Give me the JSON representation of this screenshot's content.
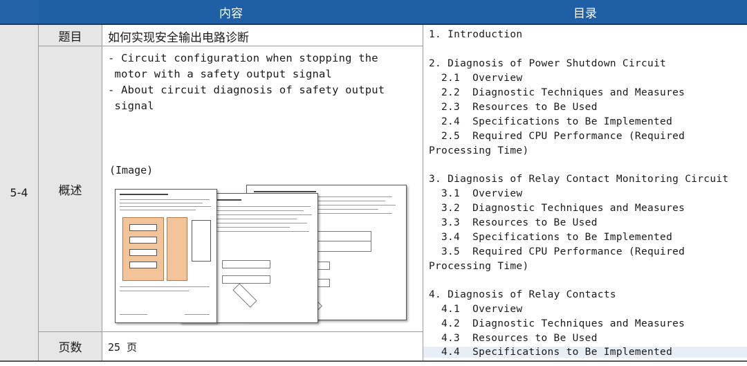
{
  "header": {
    "id_col": "",
    "content_col": "内容",
    "toc_col": "目录"
  },
  "row_id": "5-4",
  "rows": {
    "title": {
      "label": "题目",
      "value": "如何实现安全输出电路诊断"
    },
    "summary": {
      "label": "概述",
      "text": "- Circuit configuration when stopping the\n motor with a safety output signal\n- About circuit diagnosis of safety output\n signal",
      "image_label": "(Image)"
    },
    "pages": {
      "label": "页数",
      "value": "25 页"
    }
  },
  "toc": [
    "1. Introduction",
    "",
    "2. Diagnosis of Power Shutdown Circuit",
    "2.1  Overview",
    "2.2  Diagnostic Techniques and Measures",
    "2.3  Resources to Be Used",
    "2.4  Specifications to Be Implemented",
    "2.5  Required CPU Performance (Required",
    "Processing Time)",
    "",
    "3. Diagnosis of Relay Contact Monitoring Circuit",
    "3.1  Overview",
    "3.2  Diagnostic Techniques and Measures",
    "3.3  Resources to Be Used",
    "3.4  Specifications to Be Implemented",
    "3.5  Required CPU Performance (Required",
    "Processing Time)",
    "",
    "4. Diagnosis of Relay Contacts",
    "4.1  Overview",
    "4.2  Diagnostic Techniques and Measures",
    "4.3  Resources to Be Used",
    "4.4  Specifications to Be Implemented"
  ],
  "colors": {
    "header_bg": "#1f5fa6",
    "label_bg": "#e6e6e6",
    "diagram_orange": "#f3c49a"
  }
}
